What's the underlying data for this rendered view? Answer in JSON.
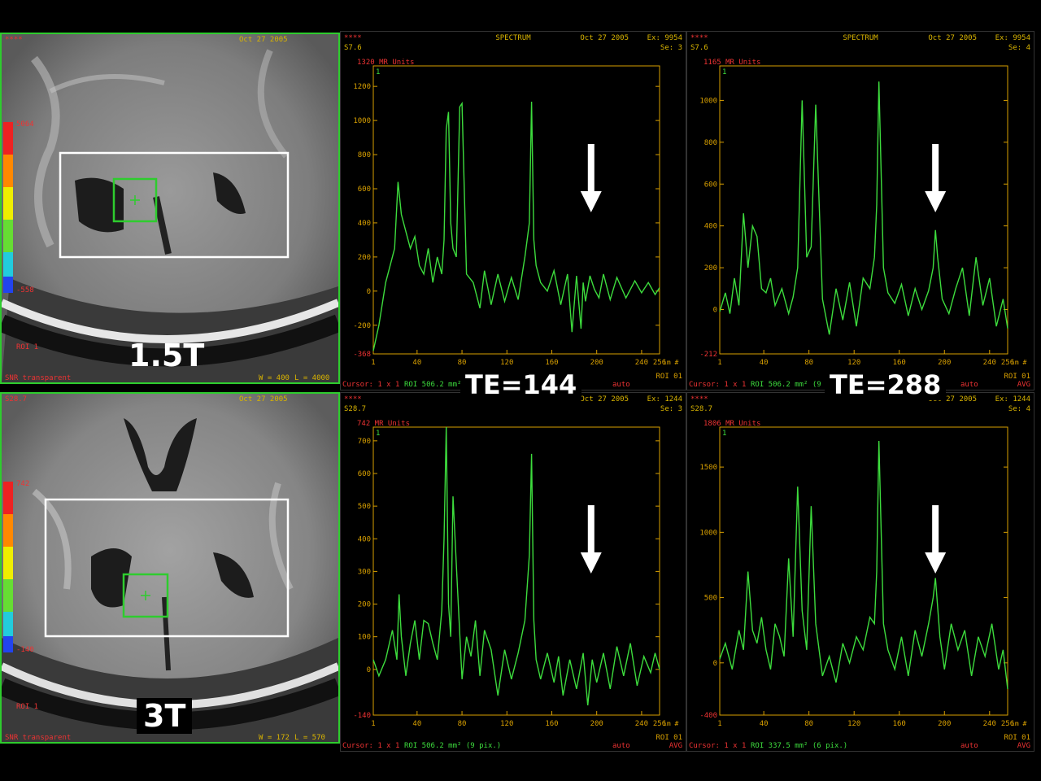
{
  "labels": {
    "field_top": "1.5T",
    "field_bottom": "3T",
    "te_left": "TE=144",
    "te_right": "TE=288"
  },
  "mri_overlay": {
    "top": {
      "left_top": "****",
      "date": "Oct 27 2005",
      "scale_hi": "5064",
      "scale_lo": "-558",
      "roi": "ROI 1",
      "footer": "SNR transparent",
      "w": "W = 400",
      "l": "L = 4000"
    },
    "bottom": {
      "left_top": "S28.7",
      "date": "Oct 27 2005",
      "scale_hi": "742",
      "scale_lo": "-140",
      "roi": "ROI 1",
      "footer": "SNR transparent",
      "w": "W = 172",
      "l": "L = 570"
    }
  },
  "colors": {
    "trace": "#3ddc3d",
    "axis": "#d9a000",
    "roi_box": "#ffffff",
    "voxel": "#2ecc2e"
  },
  "chart_data": [
    {
      "type": "line",
      "header": {
        "stars": "****",
        "slice": "S7.6",
        "title": "SPECTRUM",
        "date": "Oct 27 2005",
        "ex": "Ex: 9954",
        "se": "Se: 3"
      },
      "ylabel": "1320 MR Units",
      "ylim": [
        -368,
        1320
      ],
      "yticks": [
        -200,
        0,
        200,
        400,
        600,
        800,
        1000,
        1200
      ],
      "ytick_labels": [
        "-200",
        "0",
        "200",
        "400",
        "600",
        "800",
        "1000",
        "1200"
      ],
      "ymin_label": "-368",
      "xlim": [
        1,
        256
      ],
      "xticks": [
        1,
        40,
        80,
        120,
        160,
        200,
        240,
        256
      ],
      "xticks_labels": [
        "1",
        "40",
        "80",
        "120",
        "160",
        "200",
        "240",
        "256"
      ],
      "xunit": "im #",
      "footer": {
        "cursor": "Cursor: 1 x 1",
        "roi": "ROI 506.2 mm² (9 pix.)",
        "auto": "auto",
        "roi_id": "ROI 01"
      },
      "arrow_x": 195,
      "series": [
        {
          "x": [
            1,
            6,
            12,
            16,
            20,
            23,
            26,
            30,
            34,
            38,
            42,
            46,
            50,
            54,
            58,
            62,
            64,
            66,
            68,
            70,
            72,
            75,
            78,
            80,
            84,
            90,
            96,
            100,
            106,
            112,
            118,
            124,
            130,
            136,
            140,
            142,
            144,
            146,
            150,
            156,
            162,
            168,
            174,
            178,
            182,
            186,
            188,
            190,
            194,
            198,
            202,
            206,
            212,
            218,
            226,
            234,
            240,
            246,
            252,
            256
          ],
          "y": [
            -350,
            -200,
            50,
            150,
            250,
            640,
            450,
            350,
            250,
            320,
            150,
            100,
            250,
            50,
            200,
            100,
            300,
            950,
            1050,
            400,
            250,
            200,
            1080,
            1100,
            100,
            50,
            -100,
            120,
            -80,
            100,
            -60,
            80,
            -50,
            200,
            400,
            1110,
            300,
            150,
            50,
            0,
            120,
            -80,
            100,
            -240,
            90,
            -220,
            50,
            -60,
            90,
            10,
            -40,
            100,
            -50,
            80,
            -40,
            60,
            -10,
            50,
            -20,
            20
          ]
        }
      ]
    },
    {
      "type": "line",
      "header": {
        "stars": "****",
        "slice": "S7.6",
        "title": "SPECTRUM",
        "date": "Oct 27 2005",
        "ex": "Ex: 9954",
        "se": "Se: 4"
      },
      "ylabel": "1165 MR Units",
      "ylim": [
        -212,
        1165
      ],
      "yticks": [
        0,
        200,
        400,
        600,
        800,
        1000
      ],
      "ytick_labels": [
        "0",
        "200",
        "400",
        "600",
        "800",
        "1000"
      ],
      "ymin_label": "-212",
      "xlim": [
        1,
        256
      ],
      "xticks": [
        1,
        40,
        80,
        120,
        160,
        200,
        240,
        256
      ],
      "xticks_labels": [
        "1",
        "40",
        "80",
        "120",
        "160",
        "200",
        "240",
        "256"
      ],
      "xunit": "im #",
      "footer": {
        "cursor": "Cursor: 1 x 1",
        "roi": "ROI 506.2 mm² (9 p",
        "auto": "auto",
        "roi_id": "ROI 01",
        "avg": "AVG"
      },
      "arrow_x": 192,
      "series": [
        {
          "x": [
            1,
            6,
            10,
            14,
            18,
            22,
            26,
            30,
            34,
            38,
            42,
            46,
            50,
            56,
            62,
            66,
            70,
            74,
            78,
            82,
            86,
            92,
            98,
            104,
            110,
            116,
            122,
            128,
            134,
            138,
            140,
            142,
            146,
            150,
            156,
            162,
            168,
            174,
            180,
            186,
            190,
            192,
            194,
            198,
            204,
            210,
            216,
            222,
            228,
            234,
            240,
            246,
            252,
            256
          ],
          "y": [
            -10,
            80,
            -20,
            150,
            20,
            460,
            200,
            400,
            350,
            100,
            80,
            150,
            20,
            100,
            -20,
            60,
            200,
            1000,
            250,
            300,
            980,
            50,
            -120,
            100,
            -50,
            130,
            -80,
            150,
            100,
            250,
            500,
            1090,
            200,
            80,
            30,
            120,
            -30,
            100,
            0,
            90,
            200,
            380,
            250,
            50,
            -20,
            100,
            200,
            -30,
            250,
            20,
            150,
            -80,
            50,
            -90
          ]
        }
      ]
    },
    {
      "type": "line",
      "header": {
        "stars": "****",
        "slice": "S28.7",
        "title": "",
        "date": "Oct 27 2005",
        "ex": "Ex: 1244",
        "se": "Se: 3"
      },
      "ylabel": "742 MR Units",
      "ylim": [
        -140,
        742
      ],
      "yticks": [
        0,
        100,
        200,
        300,
        400,
        500,
        600,
        700
      ],
      "ytick_labels": [
        "0",
        "100",
        "200",
        "300",
        "400",
        "500",
        "600",
        "700"
      ],
      "ymin_label": "-140",
      "xlim": [
        1,
        256
      ],
      "xticks": [
        1,
        40,
        80,
        120,
        160,
        200,
        240,
        256
      ],
      "xticks_labels": [
        "1",
        "40",
        "80",
        "120",
        "160",
        "200",
        "240",
        "256"
      ],
      "xunit": "im #",
      "footer": {
        "cursor": "Cursor: 1 x 1",
        "roi": "ROI 506.2 mm² (9 pix.)",
        "auto": "auto",
        "roi_id": "ROI 01",
        "avg": "AVG"
      },
      "arrow_x": 195,
      "series": [
        {
          "x": [
            1,
            6,
            12,
            18,
            22,
            24,
            26,
            30,
            34,
            38,
            42,
            46,
            50,
            54,
            58,
            62,
            64,
            66,
            68,
            70,
            72,
            76,
            80,
            84,
            88,
            92,
            96,
            100,
            106,
            112,
            118,
            124,
            130,
            136,
            140,
            142,
            144,
            146,
            150,
            156,
            162,
            166,
            170,
            176,
            182,
            188,
            192,
            196,
            200,
            206,
            212,
            218,
            224,
            230,
            236,
            242,
            248,
            252,
            256
          ],
          "y": [
            30,
            -20,
            30,
            120,
            30,
            230,
            100,
            -20,
            80,
            150,
            30,
            150,
            140,
            80,
            30,
            180,
            400,
            742,
            200,
            100,
            530,
            250,
            -30,
            100,
            40,
            150,
            -20,
            120,
            60,
            -80,
            60,
            -30,
            50,
            150,
            350,
            660,
            150,
            30,
            -30,
            50,
            -40,
            40,
            -80,
            30,
            -60,
            50,
            -110,
            30,
            -40,
            50,
            -60,
            70,
            -20,
            80,
            -50,
            40,
            -10,
            50,
            0
          ]
        }
      ]
    },
    {
      "type": "line",
      "header": {
        "stars": "****",
        "slice": "S28.7",
        "title": "",
        "date": "Oct 27 2005",
        "ex": "Ex: 1244",
        "se": "Se: 4"
      },
      "ylabel": "1806 MR Units",
      "ylim": [
        -400,
        1806
      ],
      "yticks": [
        0,
        500,
        1000,
        1500
      ],
      "ytick_labels": [
        "0",
        "500",
        "1000",
        "1500"
      ],
      "ymin_label": "-400",
      "xlim": [
        1,
        256
      ],
      "xticks": [
        1,
        40,
        80,
        120,
        160,
        200,
        240,
        256
      ],
      "xticks_labels": [
        "1",
        "40",
        "80",
        "120",
        "160",
        "200",
        "240",
        "256"
      ],
      "xunit": "im #",
      "footer": {
        "cursor": "Cursor: 1 x 1",
        "roi": "ROI 337.5 mm² (6 pix.)",
        "auto": "auto",
        "roi_id": "ROI 01",
        "avg": "AVG"
      },
      "arrow_x": 192,
      "series": [
        {
          "x": [
            1,
            6,
            12,
            18,
            22,
            26,
            30,
            34,
            38,
            42,
            46,
            50,
            54,
            58,
            62,
            66,
            70,
            74,
            78,
            82,
            86,
            92,
            98,
            104,
            110,
            116,
            122,
            128,
            134,
            138,
            140,
            142,
            146,
            150,
            156,
            162,
            168,
            174,
            180,
            186,
            190,
            192,
            196,
            200,
            206,
            212,
            218,
            224,
            230,
            236,
            242,
            248,
            252,
            256
          ],
          "y": [
            30,
            150,
            -50,
            250,
            100,
            700,
            250,
            150,
            350,
            100,
            -50,
            300,
            200,
            50,
            800,
            200,
            1350,
            400,
            100,
            1200,
            300,
            -100,
            50,
            -150,
            150,
            0,
            200,
            100,
            350,
            300,
            700,
            1700,
            300,
            100,
            -50,
            200,
            -100,
            250,
            50,
            300,
            500,
            650,
            200,
            -50,
            300,
            100,
            250,
            -100,
            200,
            50,
            300,
            -50,
            100,
            -200
          ]
        }
      ]
    }
  ]
}
